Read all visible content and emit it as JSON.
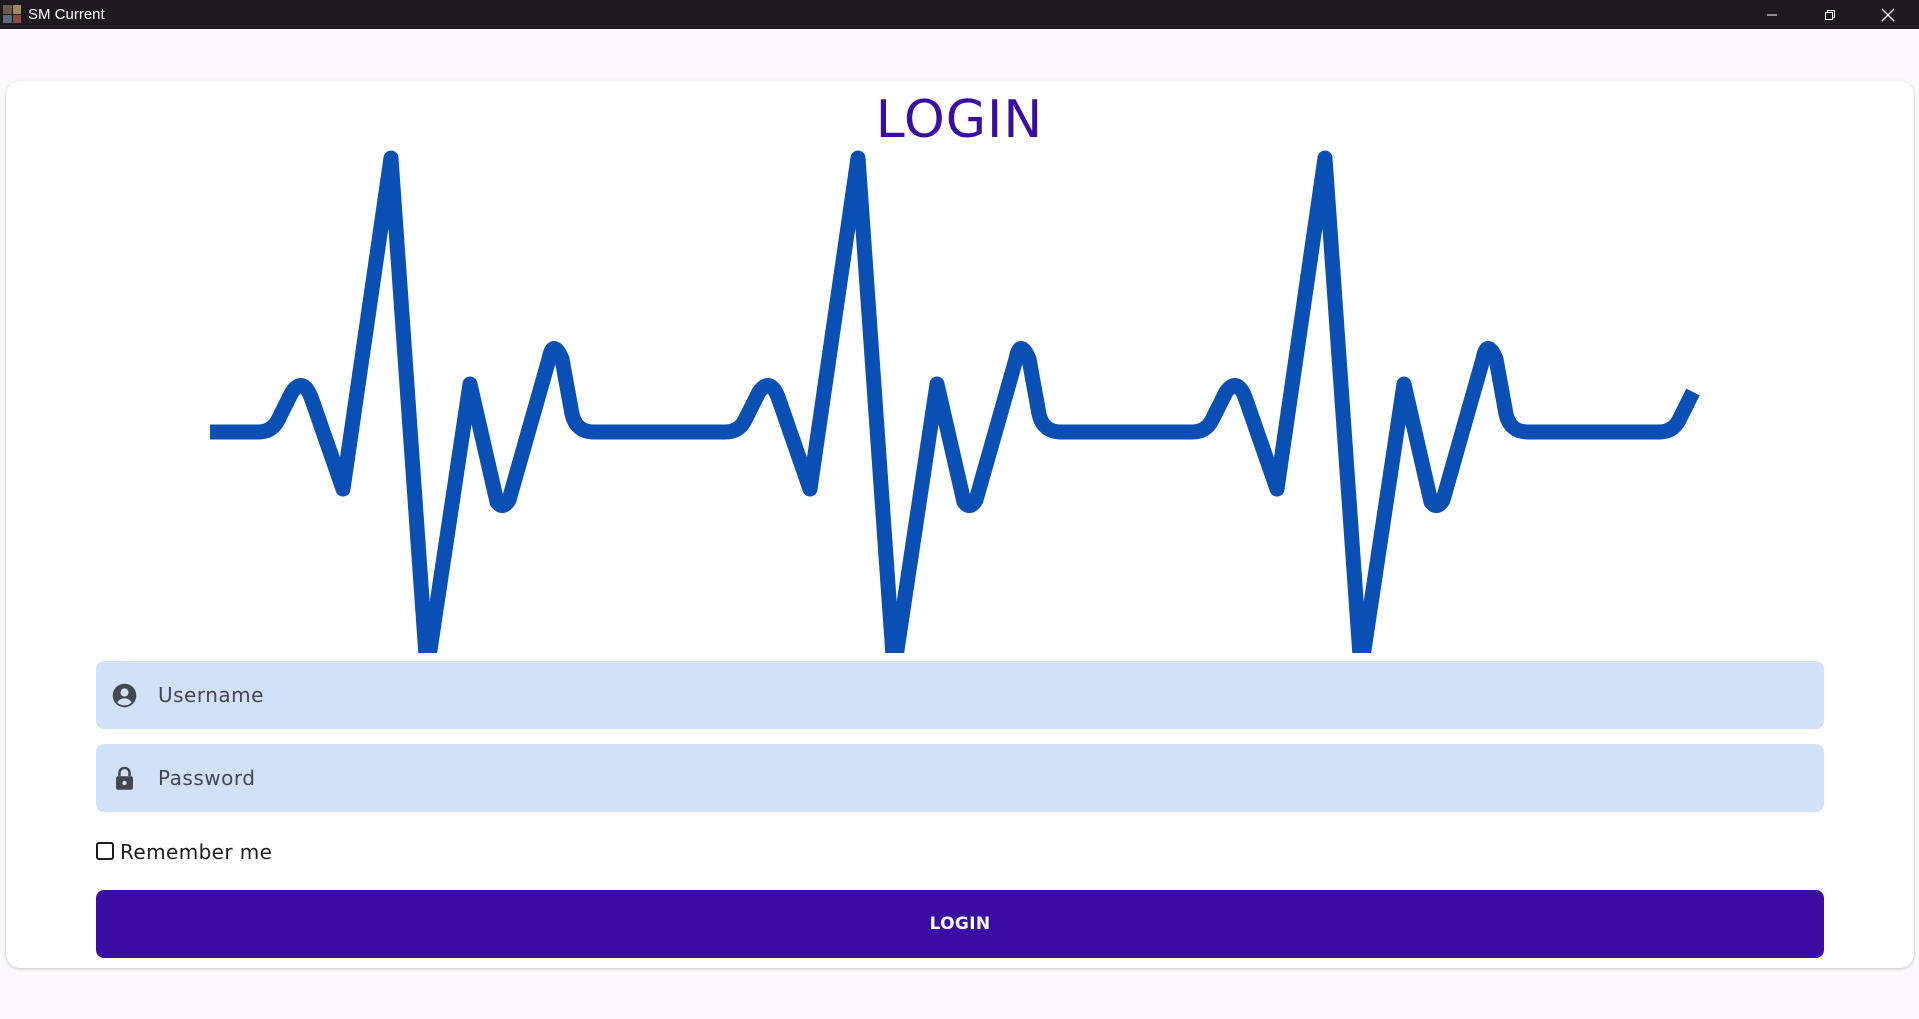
{
  "window": {
    "title": "SM Current",
    "controls": [
      "minimize-icon",
      "restore-icon",
      "close-icon"
    ]
  },
  "login": {
    "heading": "LOGIN",
    "username": {
      "placeholder": "Username",
      "value": "",
      "icon": "account-circle-icon"
    },
    "password": {
      "placeholder": "Password",
      "value": "",
      "icon": "lock-icon"
    },
    "remember_me": {
      "label": "Remember me",
      "checked": false
    },
    "submit_label": "LOGIN"
  },
  "illustration": {
    "name": "heartbeat-ecg",
    "beats": 3
  },
  "colors": {
    "accent": "#3a0ca3",
    "ecg_line": "#0a4fb4",
    "field_background": "#d0e1f9",
    "page_background": "#fdf7ff",
    "titlebar_background": "#1f1a1f"
  }
}
